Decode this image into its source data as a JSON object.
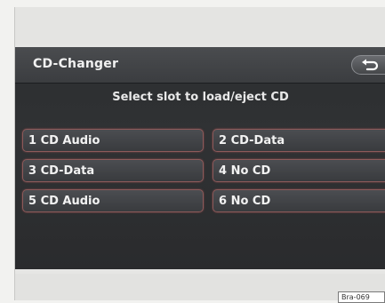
{
  "header": {
    "title": "CD-Changer",
    "back_icon": "return-arrow-icon"
  },
  "instruction": "Select slot to load/eject CD",
  "slots": [
    {
      "label": "1 CD Audio"
    },
    {
      "label": "2 CD-Data"
    },
    {
      "label": "3 CD-Data"
    },
    {
      "label": "4 No CD"
    },
    {
      "label": "5 CD Audio"
    },
    {
      "label": "6 No CD"
    }
  ],
  "figure_ref": "Bra-069",
  "colors": {
    "screen_bg": "#2e3032",
    "titlebar_bg": "#43454a",
    "slot_border": "#8e5a5a",
    "text": "#f2f2f2"
  }
}
